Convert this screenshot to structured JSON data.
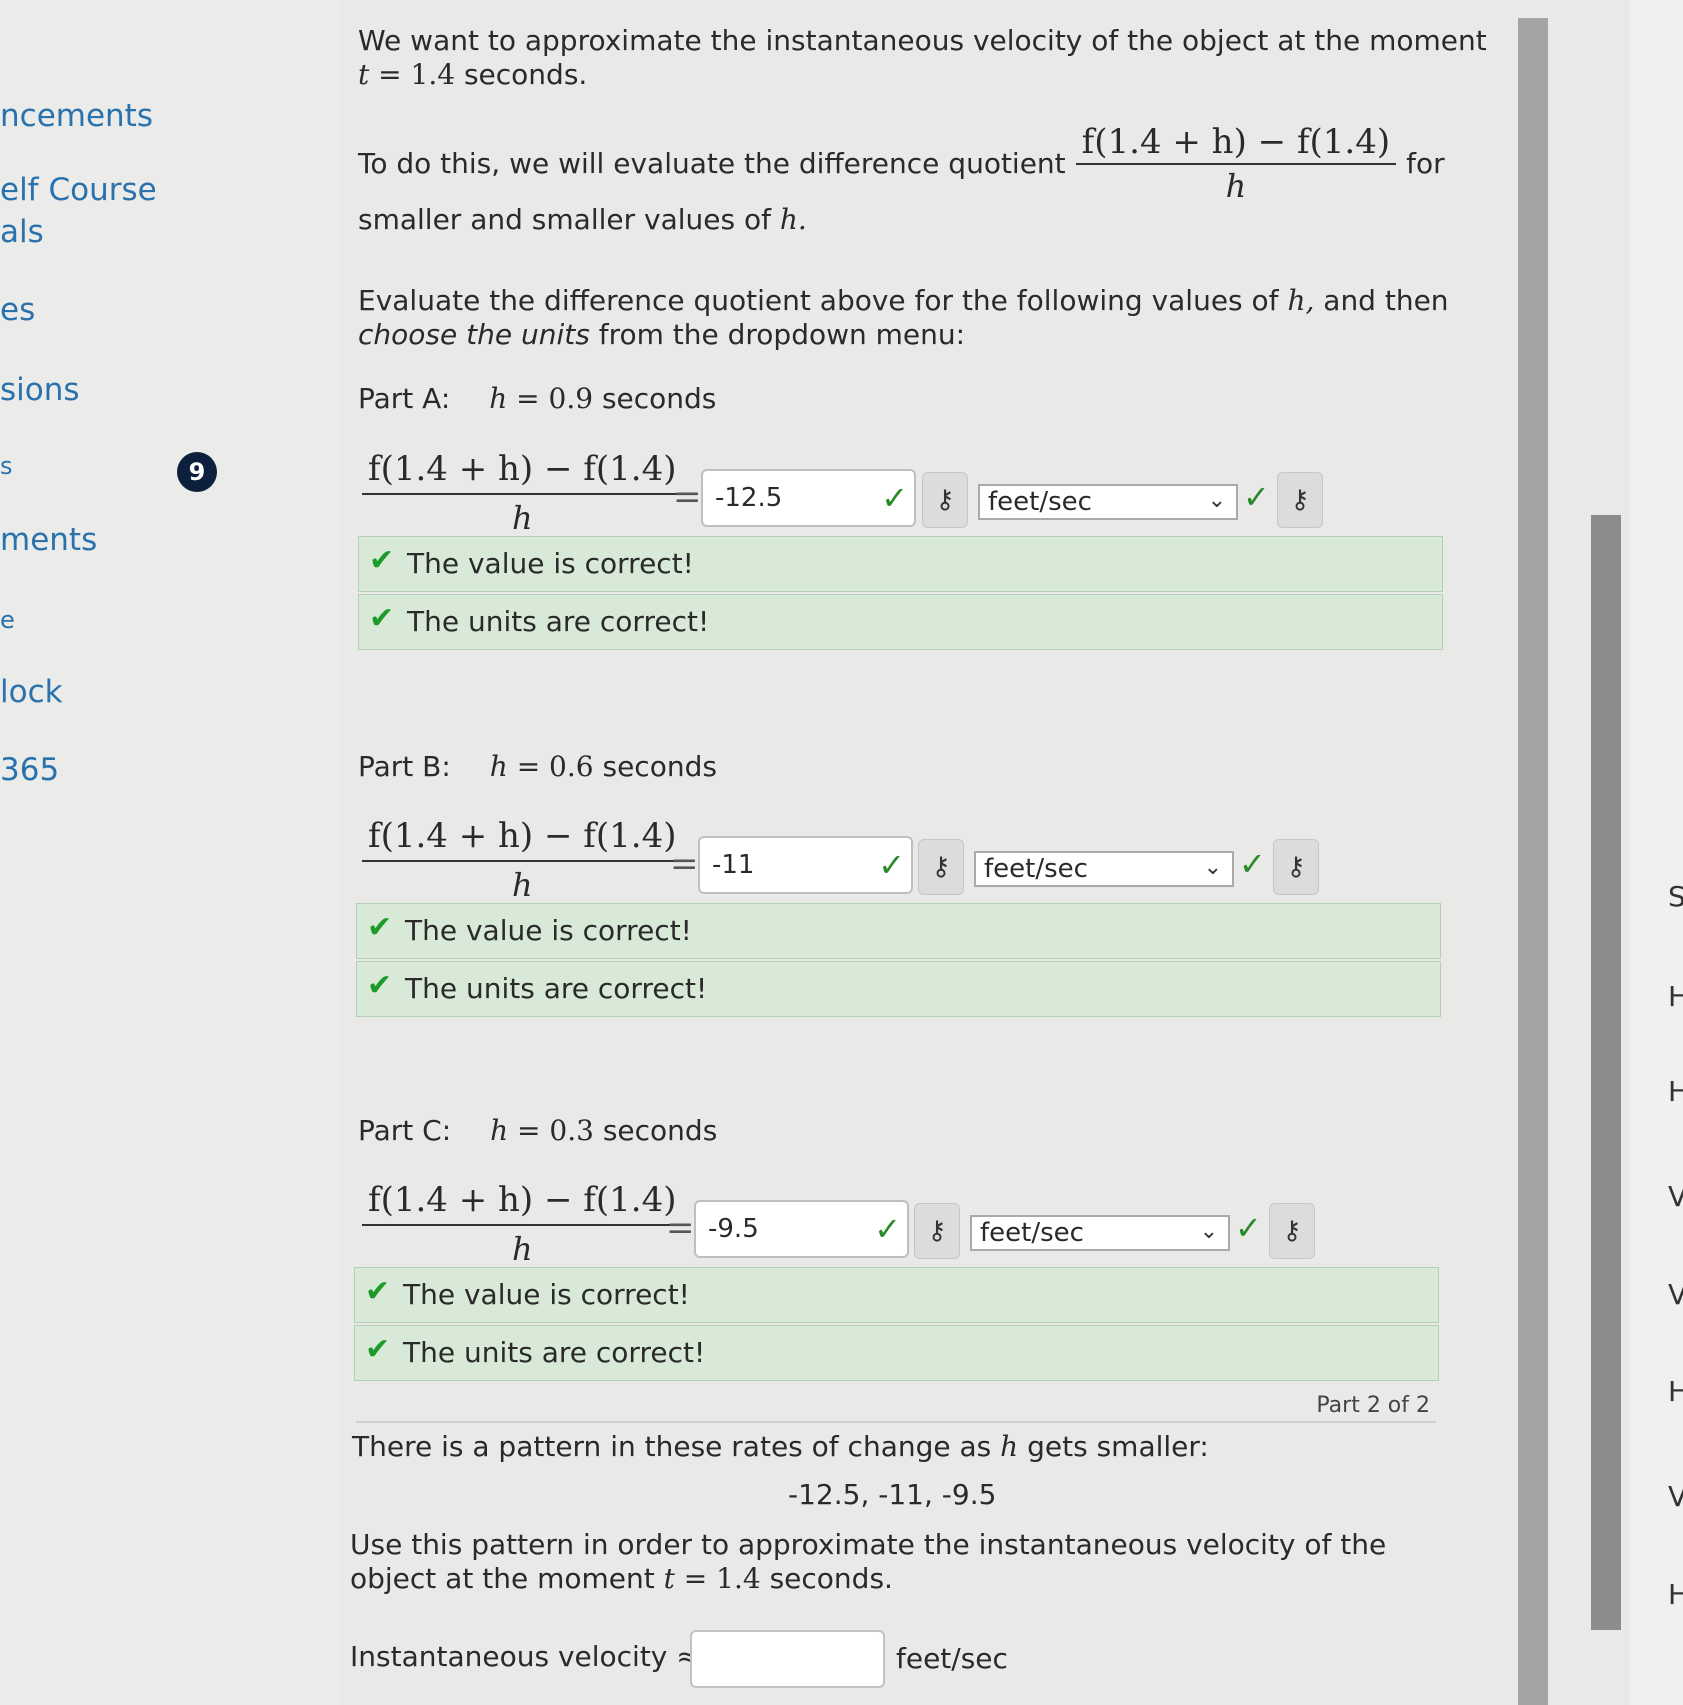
{
  "sidebar": {
    "items": [
      "ncements",
      "elf Course",
      "als",
      "es",
      "sions",
      "s",
      "ments",
      "e",
      "lock",
      "365"
    ],
    "badge": "9"
  },
  "intro": {
    "line1": "We want to approximate the instantaneous velocity of the object at the moment",
    "line2_var": "t",
    "line2_eq": "= 1.4",
    "line2_text": "seconds.",
    "dq_lead": "To do this, we will evaluate the difference quotient",
    "dq_num": "f(1.4 + h) − f(1.4)",
    "dq_den": "h",
    "dq_after": "for",
    "dq_line2": "smaller and smaller values of",
    "dq_var": "h.",
    "eval1": "Evaluate the difference quotient above for the following values of",
    "eval_var": "h,",
    "eval2": "and then",
    "eval3_em": "choose the units",
    "eval3": "from the dropdown menu:"
  },
  "expr": {
    "num": "f(1.4 + h) − f(1.4)",
    "den": "h",
    "eq": "="
  },
  "parts": [
    {
      "label": "Part A:",
      "h_var": "h",
      "h_eq": "= 0.9",
      "unit": "seconds",
      "value": "-12.5",
      "select": "feet/sec",
      "fb_value": "The value is correct!",
      "fb_units": "The units are correct!"
    },
    {
      "label": "Part B:",
      "h_var": "h",
      "h_eq": "= 0.6",
      "unit": "seconds",
      "value": "-11",
      "select": "feet/sec",
      "fb_value": "The value is correct!",
      "fb_units": "The units are correct!"
    },
    {
      "label": "Part C:",
      "h_var": "h",
      "h_eq": "= 0.3",
      "unit": "seconds",
      "value": "-9.5",
      "select": "feet/sec",
      "fb_value": "The value is correct!",
      "fb_units": "The units are correct!"
    }
  ],
  "part_count": "Part 2 of 2",
  "pattern": {
    "lead": "There is a pattern in these rates of change as",
    "var": "h",
    "tail": "gets smaller:",
    "values": "-12.5,  -11,  -9.5",
    "use1": "Use this pattern in order to approximate the instantaneous velocity of the",
    "use2": "object at the moment",
    "use2_var": "t",
    "use2_eq": "= 1.4",
    "use2_tail": "seconds."
  },
  "final": {
    "label": "Instantaneous velocity ≈",
    "unit": "feet/sec",
    "value": ""
  },
  "icons": {
    "check": "✓",
    "key": "⚷",
    "chev": "⌄",
    "feedback_check": "✔"
  },
  "edge_letters": [
    "S",
    "H",
    "H",
    "V",
    "V",
    "H",
    "V",
    "H"
  ]
}
